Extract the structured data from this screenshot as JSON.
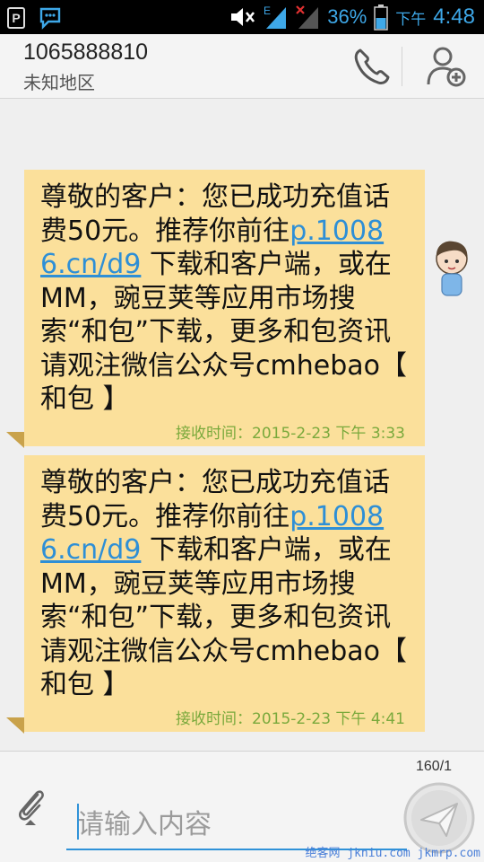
{
  "status_bar": {
    "battery_percent": "36%",
    "ampm": "下午",
    "time": "4:48",
    "network": "E",
    "icons": [
      "p-icon",
      "chat-notification-icon",
      "mute-icon",
      "signal-icon",
      "no-signal-icon",
      "battery-icon"
    ]
  },
  "header": {
    "number": "1065888810",
    "region": "未知地区",
    "call_icon": "phone-icon",
    "add_contact_icon": "add-contact-icon"
  },
  "messages": [
    {
      "text_before": "尊敬的客户：您已成功充值话费50元。推荐你前往",
      "link": "p.10086.cn/d9",
      "text_after": " 下载和客户端，或在MM，豌豆荚等应用市场搜索“和包”下载，更多和包资讯请观注微信公众号cmhebao【 和包 】",
      "time": "接收时间：2015-2-23 下午 3:33"
    },
    {
      "text_before": "尊敬的客户：您已成功充值话费50元。推荐你前往",
      "link": "p.10086.cn/d9",
      "text_after": " 下载和客户端，或在MM，豌豆荚等应用市场搜索“和包”下载，更多和包资讯请观注微信公众号cmhebao【 和包 】",
      "time": "接收时间：2015-2-23 下午 4:41"
    }
  ],
  "composer": {
    "counter": "160/1",
    "placeholder": "请输入内容",
    "attach_icon": "paperclip-icon",
    "send_icon": "send-icon"
  },
  "watermark": "绝客网 jkniu.com jkmrp.com"
}
